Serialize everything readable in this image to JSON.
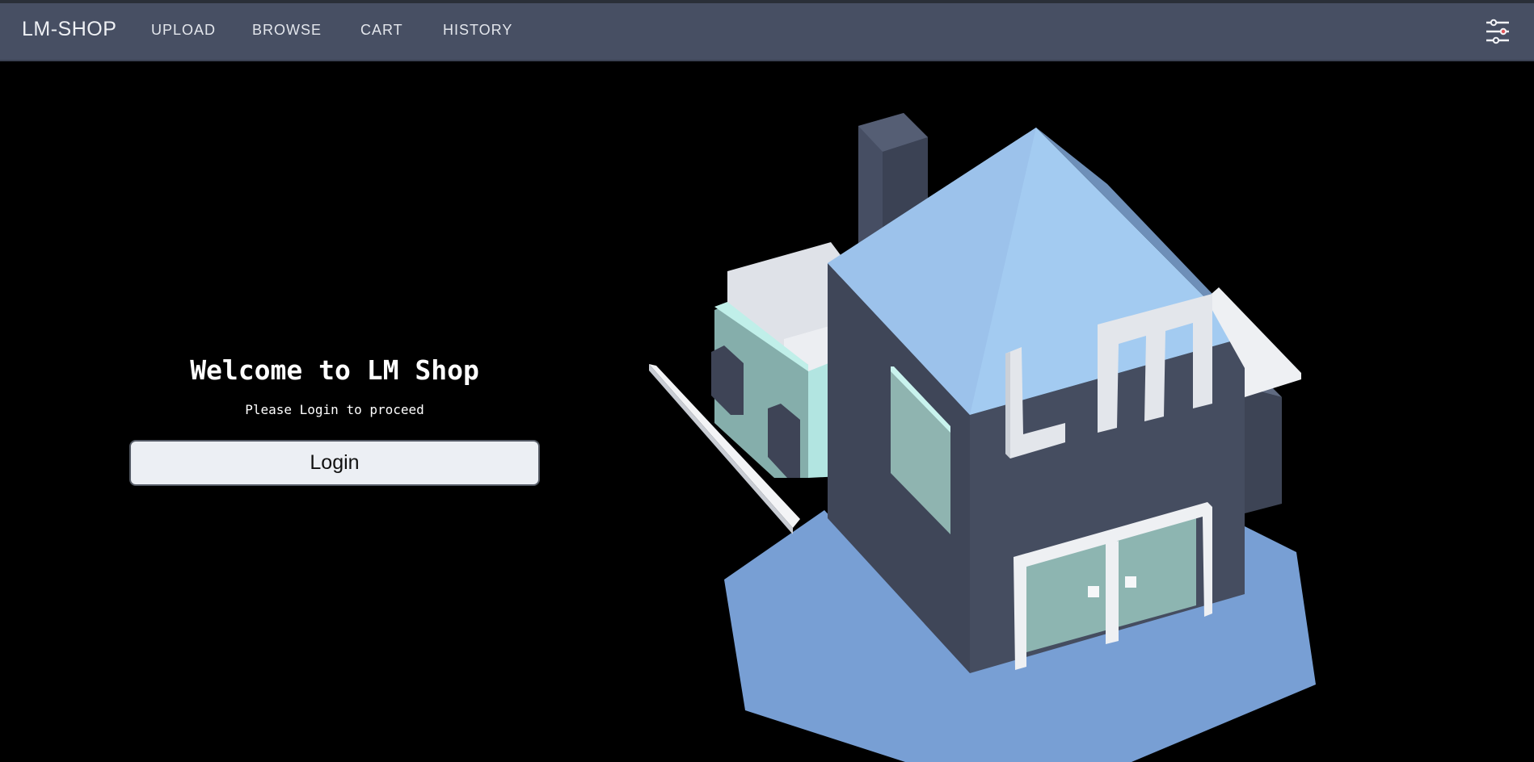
{
  "navbar": {
    "brand": "LM-SHOP",
    "links": [
      "UPLOAD",
      "BROWSE",
      "CART",
      "HISTORY"
    ],
    "settings_icon": "sliders-icon"
  },
  "hero": {
    "title": "Welcome to LM Shop",
    "subtitle": "Please Login to proceed",
    "login_label": "Login"
  },
  "colors": {
    "navbar": "#474f63",
    "background": "#000000",
    "roof": "#a3cbf1",
    "walls": "#454d60",
    "ground": "#789fd4",
    "glass": "#8db5b1",
    "accent_dot": "#e0555a"
  }
}
